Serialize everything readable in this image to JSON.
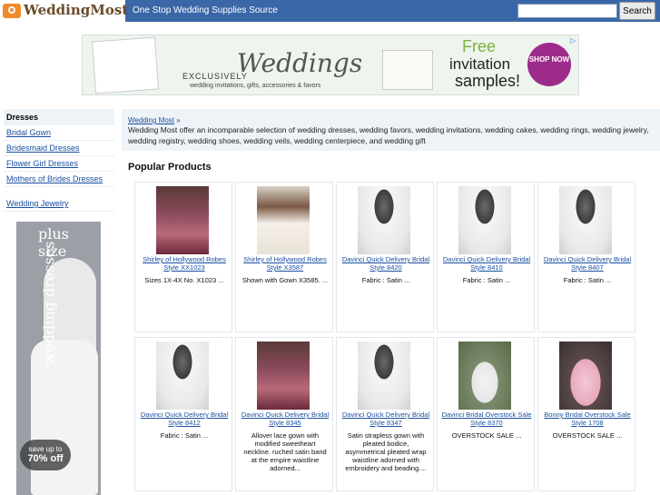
{
  "header": {
    "logo_text": "WeddingMost",
    "tagline": "One Stop Wedding Supplies Source",
    "search_value": "",
    "search_button": "Search"
  },
  "banner": {
    "exclusively": "EXCLUSIVELY",
    "brand": "Weddings",
    "subtitle": "wedding invitations, gifts, accessories & favors",
    "free": "Free",
    "invitation": "invitation",
    "samples": "samples!",
    "shop_now": "SHOP NOW",
    "ad_marker": "▷"
  },
  "sidebar": {
    "heading": "Dresses",
    "links": [
      "Bridal Gown",
      "Bridesmaid Dresses",
      "Flower Girl Dresses",
      "Mothers of Brides Dresses"
    ],
    "extra_link": "Wedding Jewelry",
    "ad": {
      "plus_size": "plus size",
      "wedding_dresses": "wedding dresses",
      "save_up_to": "save up to",
      "discount": "70% off"
    }
  },
  "main": {
    "breadcrumb": "Wedding Most",
    "breadcrumb_sep": "»",
    "intro": "Wedding Most offer an incomparable selection of wedding dresses, wedding favors, wedding invitations, wedding cakes, wedding rings, wedding jewelry, wedding registry, wedding shoes, wedding veils, wedding centerpiece, and wedding gift",
    "section_title": "Popular Products"
  },
  "products": [
    {
      "title": "Shirley of Hollywood Robes Style XX1023",
      "desc": "Sizes 1X-4X No. X1023 ...",
      "thumb": "dark"
    },
    {
      "title": "Shirley of Hollywood Robes Style X3587",
      "desc": "Shown with Gown X3585. ...",
      "thumb": "model"
    },
    {
      "title": "Davinci Quick Delivery Bridal Style 8420",
      "desc": "Fabric : Satin ...",
      "thumb": "gown"
    },
    {
      "title": "Davinci Quick Delivery Bridal Style 8410",
      "desc": "Fabric : Satin ...",
      "thumb": "gown"
    },
    {
      "title": "Davinci Quick Delivery Bridal Style 8407",
      "desc": "Fabric : Satin ...",
      "thumb": "gown"
    },
    {
      "title": "Davinci Quick Delivery Bridal Style 8412",
      "desc": "Fabric : Satin ...",
      "thumb": "gown"
    },
    {
      "title": "Davinci Quick Delivery Bridal Style 8345",
      "desc": "Allover lace gown with modified sweetheart neckline. ruched satin band at the empire waistline adorned...",
      "thumb": "dark"
    },
    {
      "title": "Davinci Quick Delivery Bridal Style 8347",
      "desc": "Satin strapless gown with pleated bodice, asymmetrical pleated wrap waistline adorned with embroidery and beading....",
      "thumb": "gown"
    },
    {
      "title": "Davinci Bridal Overstock Sale Style 8370",
      "desc": "OVERSTOCK SALE ...",
      "thumb": "outdoor"
    },
    {
      "title": "Bonny Bridal Overstock Sale Style 1708",
      "desc": "OVERSTOCK SALE ...",
      "thumb": "pink"
    }
  ],
  "colors": {
    "topbar": "#3a67a8",
    "link": "#1a4fa0",
    "sidebar_bg": "#eef3f8"
  }
}
